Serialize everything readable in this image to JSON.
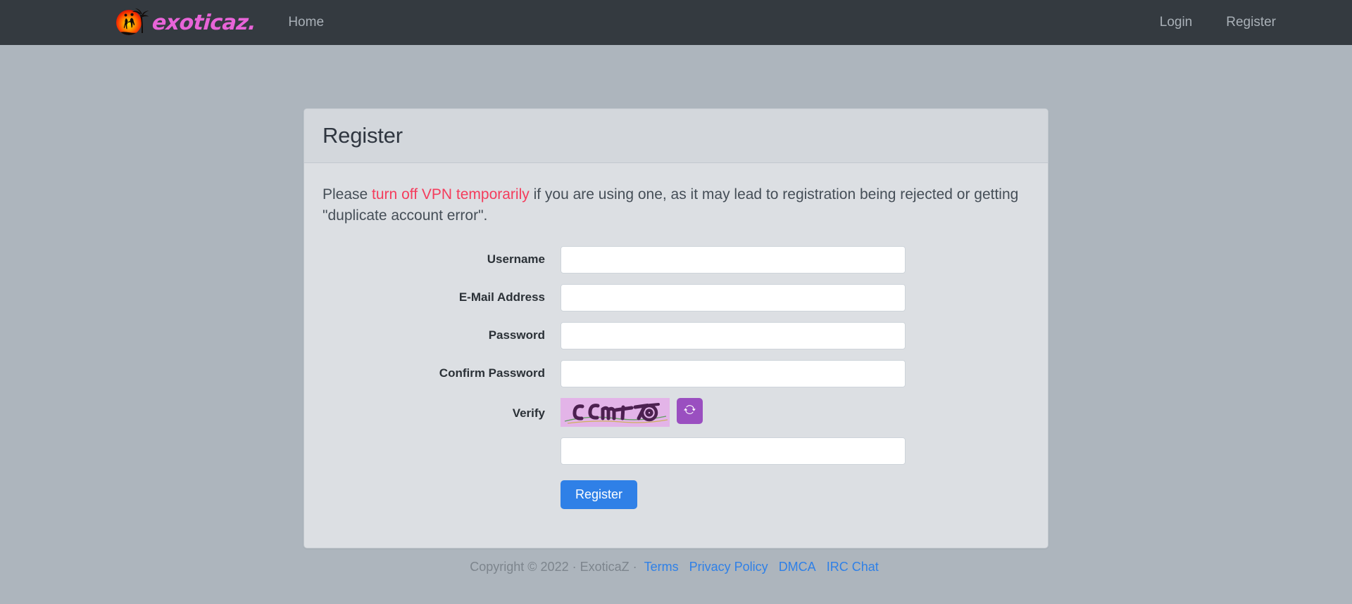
{
  "navbar": {
    "brand_text": "exoticaz.",
    "brand_icon": "sunset-silhouette-logo",
    "left_links": [
      {
        "label": "Home",
        "name": "nav-link-home"
      }
    ],
    "right_links": [
      {
        "label": "Login",
        "name": "nav-link-login"
      },
      {
        "label": "Register",
        "name": "nav-link-register"
      }
    ]
  },
  "card": {
    "title": "Register",
    "notice": {
      "before": "Please ",
      "link": "turn off VPN temporarily",
      "after": " if you are using one, as it may lead to registration being rejected or getting \"duplicate account error\"."
    }
  },
  "form": {
    "fields": [
      {
        "label": "Username",
        "value": "",
        "placeholder": "",
        "name": "username",
        "type": "text"
      },
      {
        "label": "E-Mail Address",
        "value": "",
        "placeholder": "",
        "name": "email",
        "type": "text"
      },
      {
        "label": "Password",
        "value": "",
        "placeholder": "",
        "name": "password",
        "type": "password"
      },
      {
        "label": "Confirm Password",
        "value": "",
        "placeholder": "",
        "name": "confirm-password",
        "type": "password"
      }
    ],
    "captcha": {
      "label": "Verify",
      "text": "CCm70",
      "refresh_icon": "refresh-icon",
      "input_value": "",
      "input_placeholder": "",
      "image_bg": "#e3b4e8",
      "image_fg": "#4c2050",
      "button_color": "#9a4fc0"
    },
    "submit_label": "Register",
    "submit_color": "#2f80e7"
  },
  "footer": {
    "copyright": "Copyright © 2022 · ExoticaZ ·",
    "links": [
      {
        "label": "Terms",
        "name": "footer-link-terms"
      },
      {
        "label": "Privacy Policy",
        "name": "footer-link-privacy-policy"
      },
      {
        "label": "DMCA",
        "name": "footer-link-dmca"
      },
      {
        "label": "IRC Chat",
        "name": "footer-link-irc-chat"
      }
    ]
  },
  "colors": {
    "page_bg": "#adb5bd",
    "navbar_bg": "#343a40",
    "brand_pink": "#e864d8",
    "card_bg": "#dcdfe3",
    "notice_red": "#f43c5c"
  }
}
